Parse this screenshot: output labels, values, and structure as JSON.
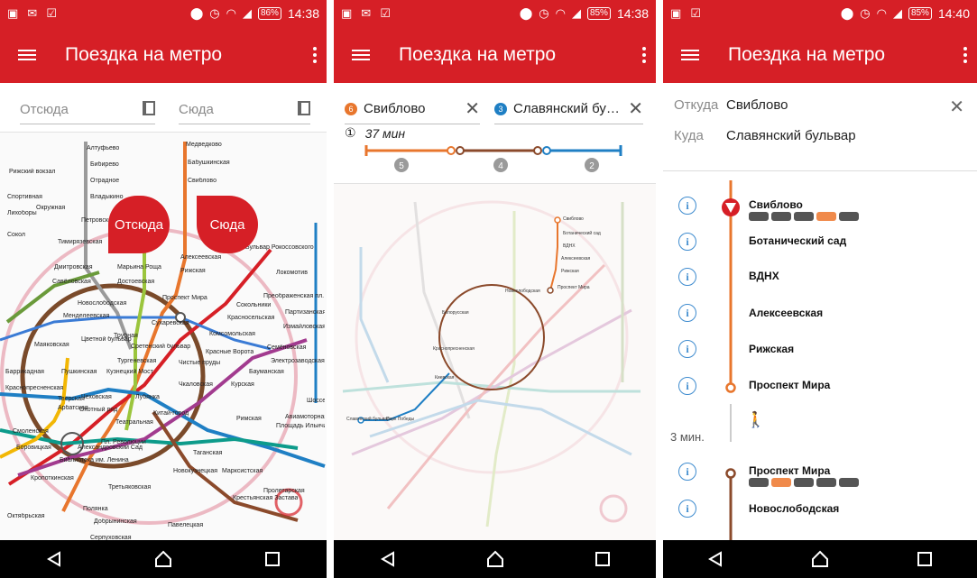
{
  "status_bars": [
    {
      "battery": "86%",
      "time": "14:38"
    },
    {
      "battery": "85%",
      "time": "14:38"
    },
    {
      "battery": "85%",
      "time": "14:40"
    }
  ],
  "app": {
    "title": "Поездка на метро"
  },
  "screen1": {
    "from_placeholder": "Отсюда",
    "to_placeholder": "Сюда",
    "pin_from": "Отсюда",
    "pin_to": "Сюда",
    "map_labels": [
      "Алтуфьево",
      "Бибирево",
      "Отрадное",
      "Владыкино",
      "Медведково",
      "Бабушкинская",
      "Свиблово",
      "Петровско-Разумовская",
      "Тимирязевская",
      "Дмитровская",
      "Савёловская",
      "Марьина Роща",
      "Достоевская",
      "Рижская",
      "Алексеевская",
      "Новослободская",
      "Менделеевская",
      "Проспект Мира",
      "Сухаревская",
      "Трубная",
      "Цветной бульвар",
      "Сретенский бульвар",
      "Тургеневская",
      "Чистые пруды",
      "Комсомольская",
      "Красносельская",
      "Сокольники",
      "Красные Ворота",
      "Маяковская",
      "Пушкинская",
      "Кузнецкий Мост",
      "Лубянка",
      "Чеховская",
      "Тверская",
      "Охотный ряд",
      "Театральная",
      "Китай-город",
      "Чкаловская",
      "Курская",
      "Бауманская",
      "Семёновская",
      "Электрозаводская",
      "Площадь Ильича",
      "Римская",
      "Арбатская",
      "Смоленская",
      "Боровицкая",
      "Александровский Сад",
      "Библиотека им. Ленина",
      "Пл. Революции",
      "Кропоткинская",
      "Таганская",
      "Марксистская",
      "Новокузнецкая",
      "Третьяковская",
      "Крестьянская Застава",
      "Пролетарская",
      "Полянка",
      "Добрынинская",
      "Павелецкая",
      "Серпуховская",
      "Преображенская пл.",
      "Локомотив",
      "Партизанская",
      "Измайловская",
      "Шоссе Энтузиастов",
      "Авиамоторная",
      "Бульвар Рокоссовского",
      "Окружная",
      "Лихоборы",
      "Краснопресненская",
      "Баррикадная",
      "Октябрьская",
      "Рижский вокзал",
      "Спортивная",
      "Сокол"
    ]
  },
  "screen2": {
    "from": {
      "line": "6",
      "name": "Свиблово",
      "color": "#e8762d"
    },
    "to": {
      "line": "3",
      "name": "Славянский бу…",
      "color": "#1f7fc4"
    },
    "duration": "37 мин",
    "segments": [
      {
        "stops": "5",
        "color": "#e8762d"
      },
      {
        "stops": "4",
        "color": "#8b4a2b"
      },
      {
        "stops": "2",
        "color": "#1f7fc4"
      }
    ],
    "map_labels": [
      "Свиблово",
      "Ботанический сад",
      "ВДНХ",
      "Алексеевская",
      "Рижская",
      "Проспект Мира",
      "Новослободская",
      "Белорусская",
      "Краснопресненская",
      "Киевская",
      "Парк Победы",
      "Славянский бульвар"
    ]
  },
  "screen3": {
    "from_label": "Откуда",
    "from_value": "Свиблово",
    "to_label": "Куда",
    "to_value": "Славянский бульвар",
    "walk_time": "3 мин.",
    "segment1": {
      "color": "#e8762d",
      "stations": [
        "Свиблово",
        "Ботанический сад",
        "ВДНХ",
        "Алексеевская",
        "Рижская",
        "Проспект Мира"
      ]
    },
    "segment2": {
      "color": "#8b4a2b",
      "stations": [
        "Проспект Мира",
        "Новослободская"
      ]
    }
  }
}
